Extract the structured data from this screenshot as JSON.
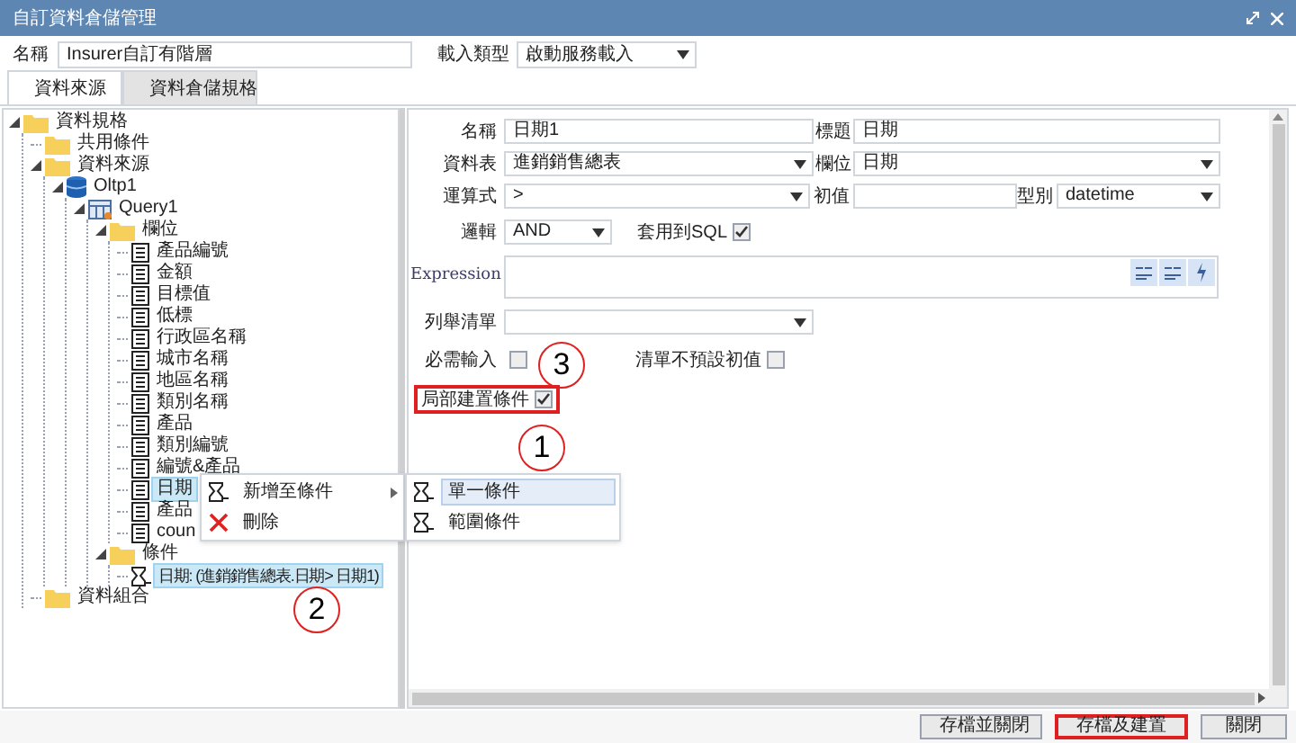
{
  "window": {
    "title": "自訂資料倉儲管理"
  },
  "header": {
    "name_label": "名稱",
    "name_value": "Insurer自訂有階層",
    "load_label": "載入類型",
    "load_value": "啟動服務載入"
  },
  "tabs": [
    {
      "label": "資料來源",
      "selected": true
    },
    {
      "label": "資料倉儲規格",
      "selected": false
    }
  ],
  "tree": [
    {
      "label": "資料規格",
      "kind": "folder",
      "expanded": true,
      "selected": false,
      "children": [
        {
          "label": "共用條件",
          "kind": "folder",
          "selected": false
        },
        {
          "label": "資料來源",
          "kind": "folder",
          "expanded": true,
          "selected": false,
          "children": [
            {
              "label": "Oltp1",
              "kind": "database",
              "expanded": true,
              "selected": false,
              "children": [
                {
                  "label": "Query1",
                  "kind": "query",
                  "expanded": true,
                  "selected": false,
                  "children": [
                    {
                      "label": "欄位",
                      "kind": "folder",
                      "expanded": true,
                      "selected": false,
                      "children": [
                        {
                          "label": "產品編號",
                          "kind": "field",
                          "selected": false
                        },
                        {
                          "label": "金額",
                          "kind": "field",
                          "selected": false
                        },
                        {
                          "label": "目標值",
                          "kind": "field",
                          "selected": false
                        },
                        {
                          "label": "低標",
                          "kind": "field",
                          "selected": false
                        },
                        {
                          "label": "行政區名稱",
                          "kind": "field",
                          "selected": false
                        },
                        {
                          "label": "城市名稱",
                          "kind": "field",
                          "selected": false
                        },
                        {
                          "label": "地區名稱",
                          "kind": "field",
                          "selected": false
                        },
                        {
                          "label": "類別名稱",
                          "kind": "field",
                          "selected": false
                        },
                        {
                          "label": "產品",
                          "kind": "field",
                          "selected": false
                        },
                        {
                          "label": "類別編號",
                          "kind": "field",
                          "selected": false
                        },
                        {
                          "label": "編號&產品",
                          "kind": "field",
                          "selected": false
                        },
                        {
                          "label": "日期",
                          "kind": "field",
                          "selected": true
                        },
                        {
                          "label": "產品",
                          "kind": "field",
                          "selected": false
                        },
                        {
                          "label": "coun",
                          "kind": "field",
                          "selected": false
                        }
                      ]
                    },
                    {
                      "label": "條件",
                      "kind": "folder",
                      "expanded": true,
                      "selected": false,
                      "children": [
                        {
                          "label": "日期: (進銷銷售總表.日期> 日期1)",
                          "kind": "filter",
                          "selected": true
                        }
                      ]
                    }
                  ]
                }
              ]
            }
          ]
        },
        {
          "label": "資料組合",
          "kind": "folder",
          "selected": false
        }
      ]
    }
  ],
  "context_menu": {
    "items": [
      {
        "label": "新增至條件",
        "kind": "filter",
        "submenu": true
      },
      {
        "label": "刪除",
        "kind": "delete",
        "submenu": false
      }
    ],
    "submenu": [
      {
        "label": "單一條件",
        "selected": true
      },
      {
        "label": "範圍條件",
        "selected": false
      }
    ]
  },
  "form": {
    "rows": [
      [
        {
          "kind": "text",
          "label": "名稱",
          "value": "日期1"
        },
        {
          "kind": "text",
          "label": "標題",
          "value": "日期"
        }
      ],
      [
        {
          "kind": "select",
          "label": "資料表",
          "value": "進銷銷售總表"
        },
        {
          "kind": "select",
          "label": "欄位",
          "value": "日期"
        }
      ],
      [
        {
          "kind": "select",
          "label": "運算式",
          "value": ">"
        },
        {
          "kind": "text",
          "label": "初值"
        },
        {
          "kind": "select",
          "label": "型別",
          "value": "datetime"
        }
      ],
      [
        {
          "kind": "select",
          "label": "邏輯",
          "value": "AND"
        },
        {
          "kind": "checkbox",
          "label": "套用到SQL",
          "checked": true,
          "outlined": false
        }
      ],
      [
        {
          "kind": "expression",
          "label": "Expression"
        }
      ],
      [
        {
          "kind": "select",
          "label": "列舉清單"
        }
      ],
      [
        {
          "kind": "checkbox",
          "label": "必需輸入",
          "checked": false,
          "outlined": false
        },
        {
          "kind": "checkbox",
          "label": "清單不預設初值",
          "checked": false,
          "outlined": false
        }
      ],
      [
        {
          "kind": "checkbox",
          "label": "局部建置條件",
          "checked": true,
          "outlined": true
        }
      ]
    ]
  },
  "annotations": [
    {
      "text": "1"
    },
    {
      "text": "2"
    },
    {
      "text": "3"
    }
  ],
  "buttons": [
    {
      "label": "存檔並關閉",
      "highlighted": false
    },
    {
      "label": "存檔及建置",
      "highlighted": true
    },
    {
      "label": "關閉",
      "highlighted": false
    }
  ]
}
